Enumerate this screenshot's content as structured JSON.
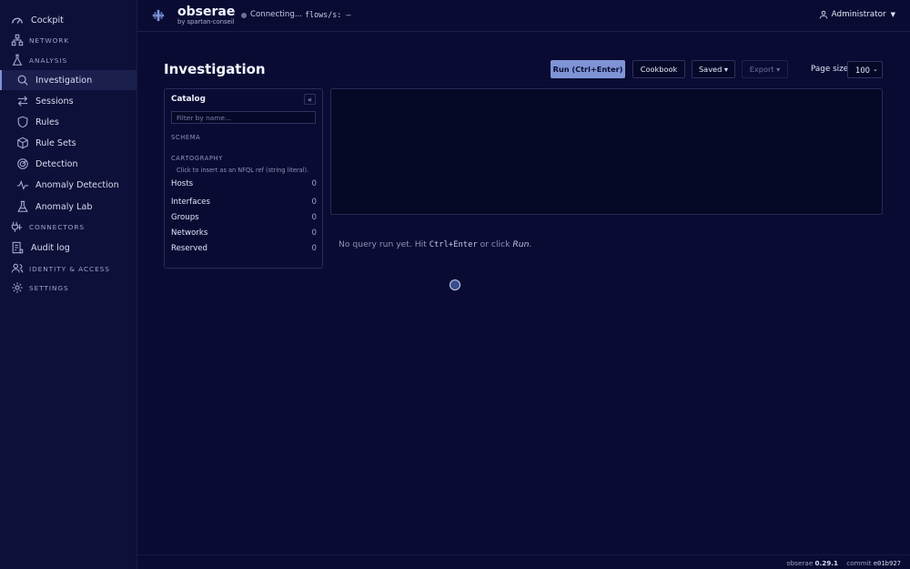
{
  "sidebar": {
    "items": [
      {
        "label": "Cockpit",
        "icon": "gauge-icon"
      },
      {
        "label": "NETWORK",
        "icon": "network-icon"
      },
      {
        "label": "ANALYSIS",
        "icon": "flask-icon"
      },
      {
        "label": "Investigation",
        "icon": "search-icon"
      },
      {
        "label": "Sessions",
        "icon": "arrows-icon"
      },
      {
        "label": "Rules",
        "icon": "shield-icon"
      },
      {
        "label": "Rule Sets",
        "icon": "cube-icon"
      },
      {
        "label": "Detection",
        "icon": "radar-icon"
      },
      {
        "label": "Anomaly Detection",
        "icon": "pulse-icon"
      },
      {
        "label": "Anomaly Lab",
        "icon": "beaker-icon"
      },
      {
        "label": "CONNECTORS",
        "icon": "plug-icon"
      },
      {
        "label": "Audit log",
        "icon": "log-icon"
      },
      {
        "label": "IDENTITY & ACCESS",
        "icon": "users-icon"
      },
      {
        "label": "SETTINGS",
        "icon": "gear-icon"
      }
    ]
  },
  "header": {
    "brand": "obserae",
    "brand_sub": "by spartan-conseil",
    "status": "Connecting...",
    "flows": "flows/s: –",
    "user": "Administrator"
  },
  "page": {
    "title": "Investigation",
    "run_label": "Run (Ctrl+Enter)",
    "cookbook_label": "Cookbook",
    "saved_label": "Saved ▾",
    "export_label": "Export ▾",
    "page_size_label": "Page size",
    "page_size_value": "100"
  },
  "catalog": {
    "title": "Catalog",
    "collapse": "«",
    "filter_placeholder": "Filter by name...",
    "schema_label": "SCHEMA",
    "cartography_label": "CARTOGRAPHY",
    "hint": "Click to insert as an NFQL ref (string literal).",
    "rows": [
      {
        "label": "Hosts",
        "count": "0"
      },
      {
        "label": "Interfaces",
        "count": "0"
      },
      {
        "label": "Groups",
        "count": "0"
      },
      {
        "label": "Networks",
        "count": "0"
      },
      {
        "label": "Reserved",
        "count": "0"
      }
    ]
  },
  "results": {
    "empty_prefix": "No query run yet. Hit ",
    "empty_key": "Ctrl+Enter",
    "empty_middle": " or click ",
    "empty_action": "Run",
    "empty_suffix": "."
  },
  "footer": {
    "version_label": "obserae ",
    "version": "0.29.1",
    "commit_label": "commit ",
    "commit": "e01b927"
  },
  "colors": {
    "background": "#0a0b33",
    "sidebar": "#0d1038",
    "accent": "#7e94d6"
  }
}
